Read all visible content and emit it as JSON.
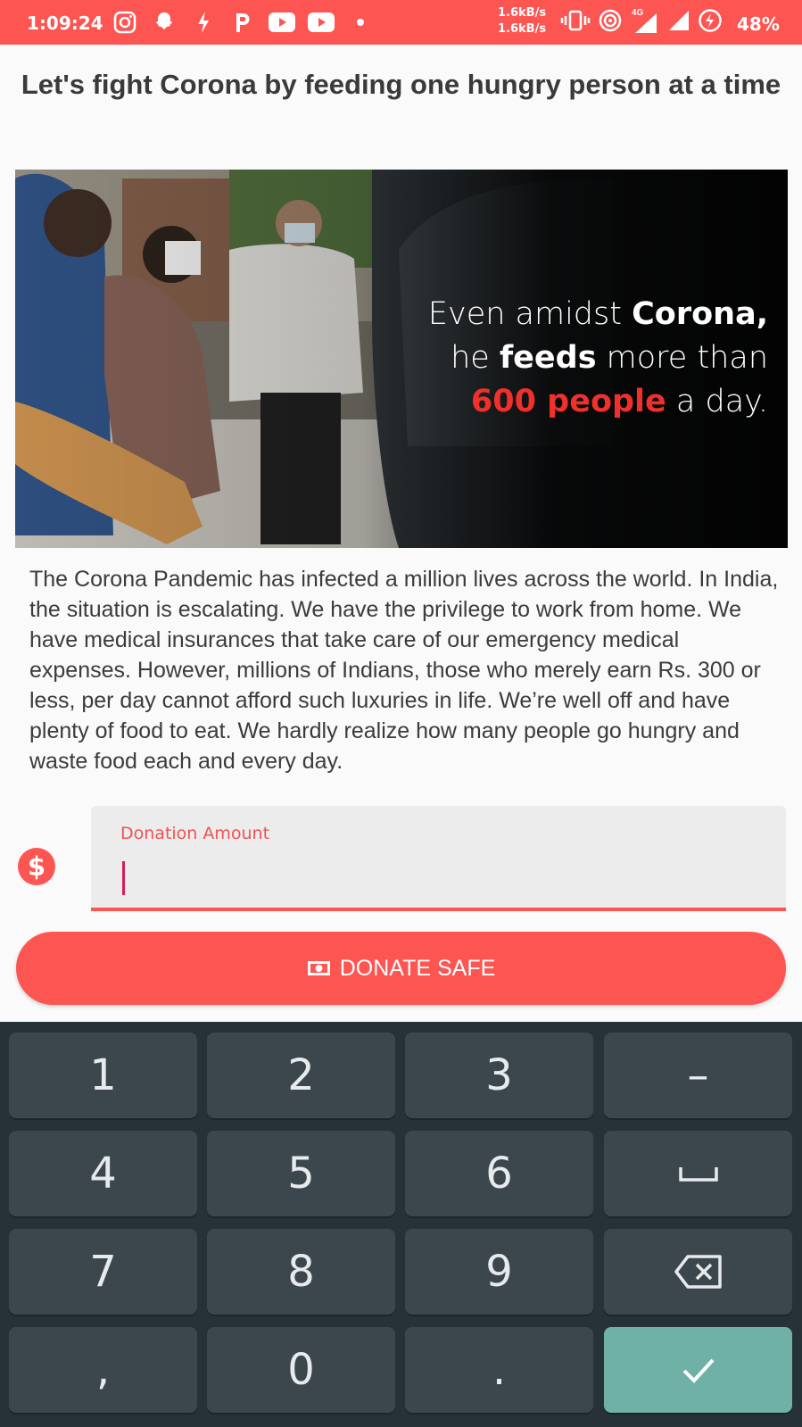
{
  "status_bar": {
    "time": "1:09:24",
    "net_speed_up": "1.6kB/s",
    "net_speed_down": "1.6kB/s",
    "network_type": "4G",
    "battery": "48%",
    "notification_icons": [
      "instagram-icon",
      "snapchat-icon",
      "flash-icon",
      "p-icon",
      "youtube-icon",
      "youtube-icon",
      "dot-icon"
    ]
  },
  "page": {
    "title": "Let's fight Corona by feeding one hungry person at a time"
  },
  "hero": {
    "line1_light": "Even amidst ",
    "line1_bold": "Corona,",
    "line2_light_a": "he ",
    "line2_bold": "feeds",
    "line2_light_b": " more than",
    "line3_red": "600 people",
    "line3_light": " a day."
  },
  "description": "The Corona Pandemic has infected a million lives across the world. In India, the situation is escalating. We have the privilege to work from home. We have medical insurances that take care of our emergency medical expenses. However, millions of Indians, those who merely earn Rs. 300 or less, per day cannot afford such luxuries in life. We’re well off and have plenty of food to eat. We hardly realize how many people go hungry and waste food each and every day.",
  "donation": {
    "icon": "$",
    "label": "Donation Amount",
    "value": "",
    "button_label": "DONATE SAFE"
  },
  "keyboard": {
    "keys": [
      "1",
      "2",
      "3",
      "–",
      "4",
      "5",
      "6",
      "␣",
      "7",
      "8",
      "9",
      "⌫",
      ",",
      "0",
      ".",
      "✓"
    ]
  },
  "colors": {
    "accent": "#fd5552",
    "keyboard_bg": "#263238",
    "key_bg": "#3c474d",
    "enter_key": "#6fb1a6",
    "caret": "#d81b60"
  }
}
